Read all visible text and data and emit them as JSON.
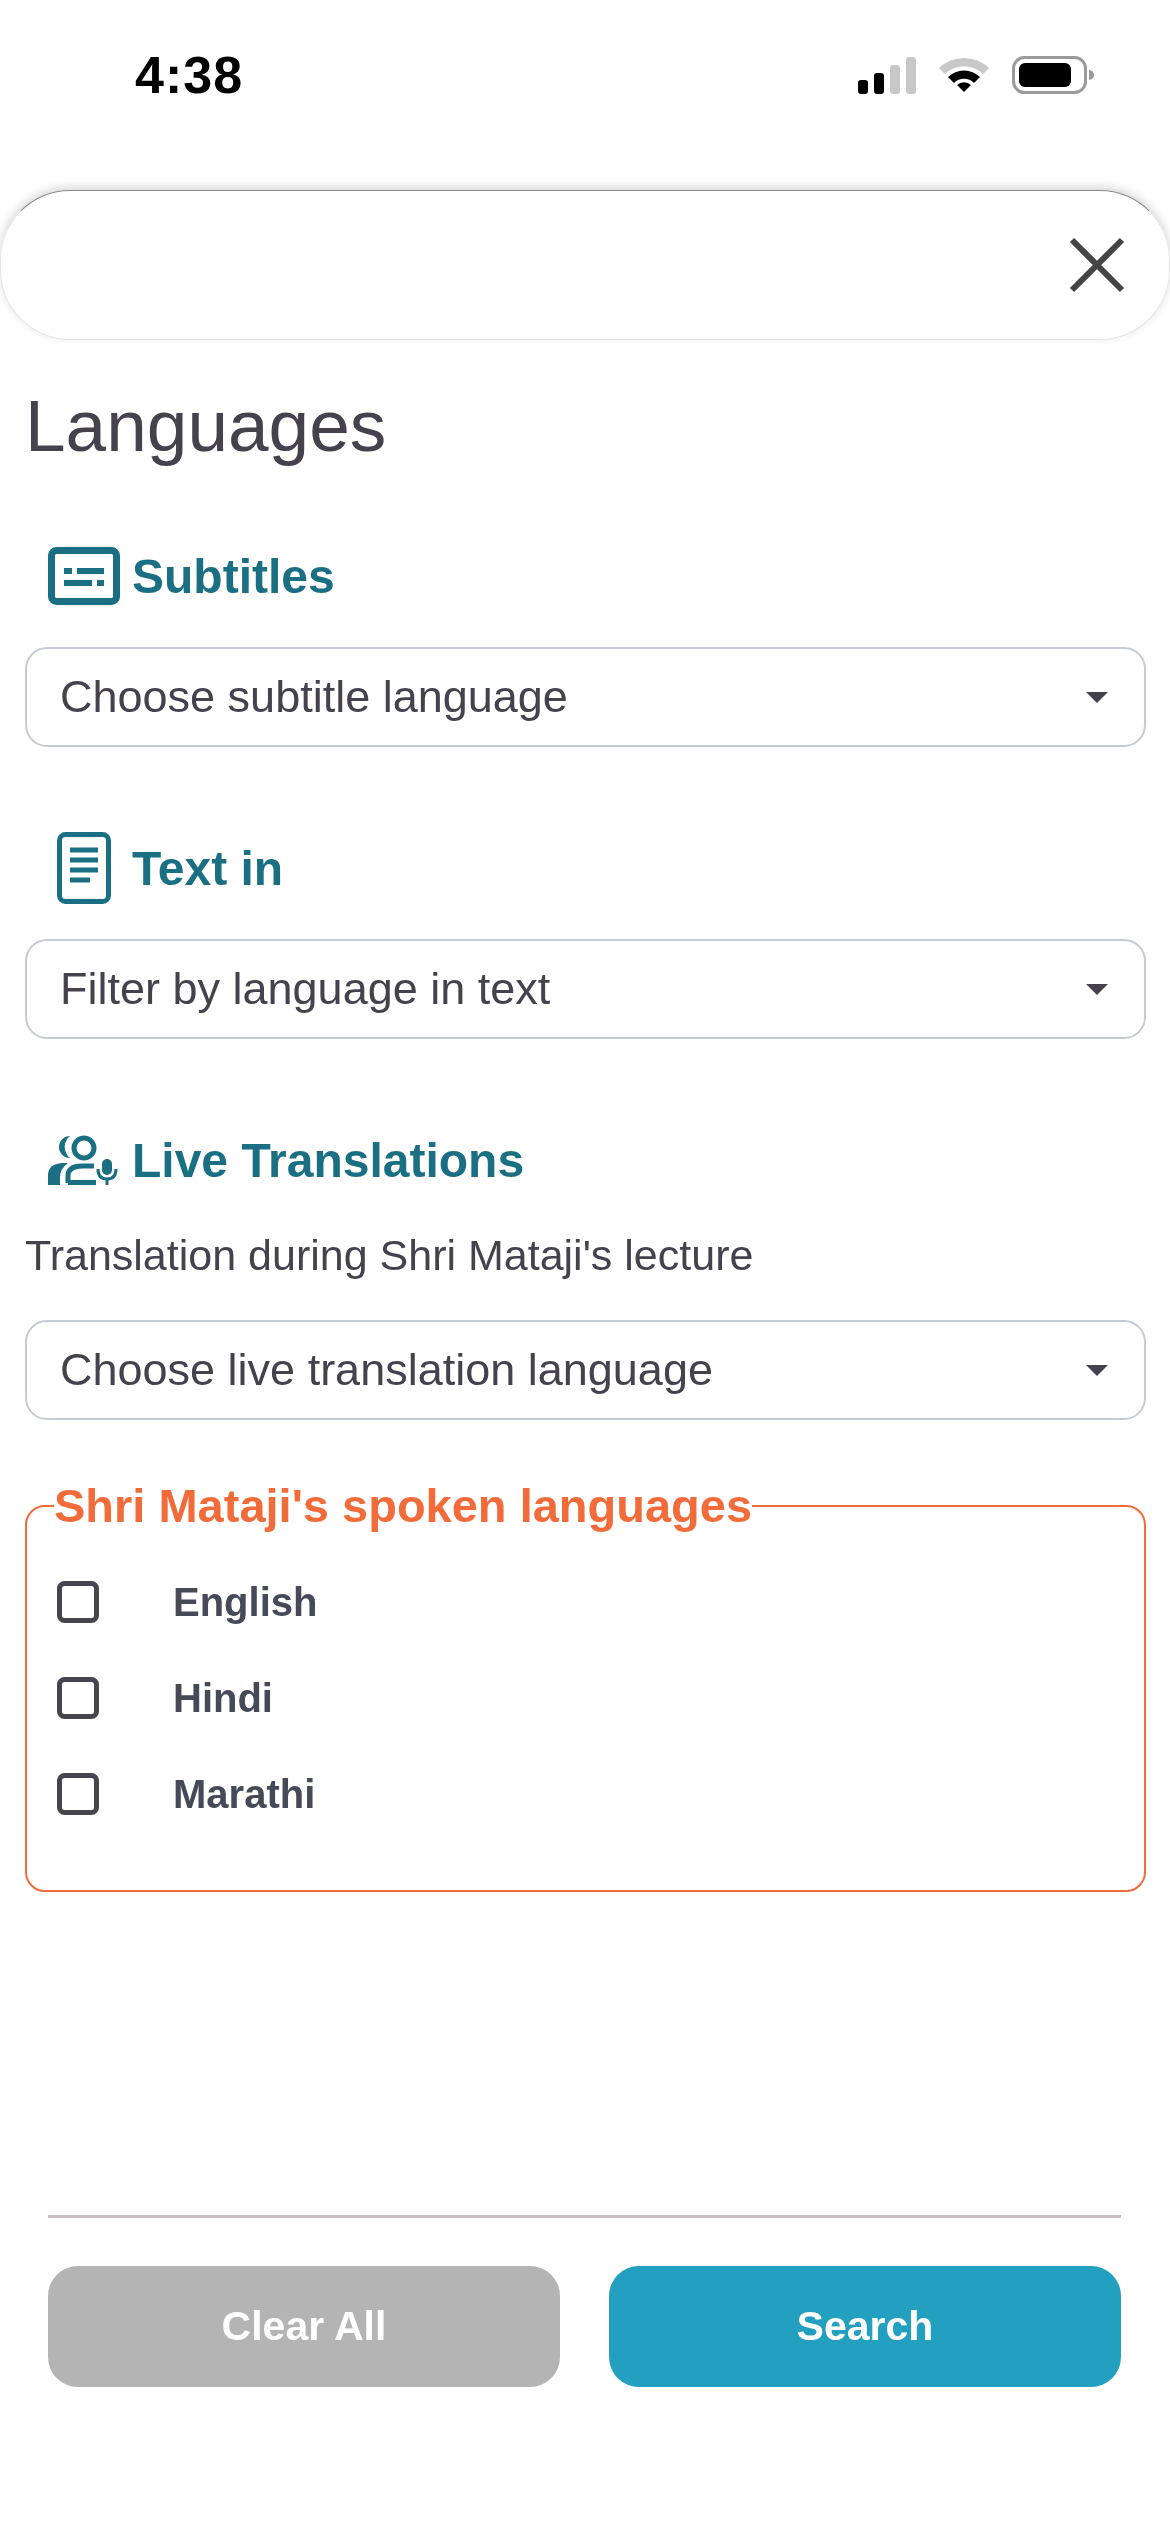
{
  "status_bar": {
    "time": "4:38"
  },
  "title": "Languages",
  "sections": [
    {
      "kind": "subtitles",
      "heading": "Subtitles",
      "dropdown": {
        "placeholder": "Choose subtitle language"
      }
    },
    {
      "kind": "text",
      "heading": "Text in",
      "dropdown": {
        "placeholder": "Filter by language in text"
      }
    },
    {
      "kind": "live",
      "heading": "Live Translations",
      "description": "Translation during Shri Mataji's lecture",
      "dropdown": {
        "placeholder": "Choose live translation language"
      }
    }
  ],
  "spoken_languages": {
    "legend": "Shri Mataji's spoken languages",
    "options": [
      {
        "label": "English",
        "checked": false
      },
      {
        "label": "Hindi",
        "checked": false
      },
      {
        "label": "Marathi",
        "checked": false
      }
    ]
  },
  "buttons": [
    {
      "label": "Clear All",
      "disabled": true
    },
    {
      "label": "Search",
      "disabled": false
    }
  ]
}
